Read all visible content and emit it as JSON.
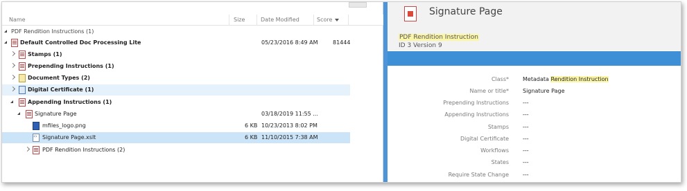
{
  "list": {
    "columns": {
      "name": "Name",
      "size": "Size",
      "date": "Date Modified",
      "score": "Score"
    },
    "group_header": "PDF Rendition Instructions (1)",
    "rows": [
      {
        "name": "Default Controlled Doc Processing Lite",
        "size": "",
        "date": "05/23/2016 8:49 AM",
        "score": "81444"
      },
      {
        "name": "Stamps",
        "count": "(1)"
      },
      {
        "name": "Prepending Instructions",
        "count": "(1)"
      },
      {
        "name": "Document Types",
        "count": "(2)"
      },
      {
        "name": "Digital Certificate",
        "count": "(1)"
      },
      {
        "name": "Appending Instructions",
        "count": "(1)"
      },
      {
        "name": "Signature Page",
        "size": "",
        "date": "03/18/2019 11:55 ...",
        "score": ""
      },
      {
        "name": "mfiles_logo.png",
        "size": "6 KB",
        "date": "10/23/2013 8:02 PM",
        "score": ""
      },
      {
        "name": "Signature Page.xslt",
        "size": "6 KB",
        "date": "11/10/2015 7:38 AM",
        "score": ""
      },
      {
        "name": "PDF Rendition Instructions",
        "count": "(2)"
      }
    ]
  },
  "details": {
    "title": "Signature Page",
    "class_name": "PDF Rendition Instruction",
    "id_version": "ID 3  Version 9",
    "properties": [
      {
        "label": "Class*",
        "value_prefix": "Metadata ",
        "value": "Rendition Instruction"
      },
      {
        "label": "Name or title*",
        "value": "Signature Page"
      },
      {
        "label": "Prepending Instructions",
        "value": "---"
      },
      {
        "label": "Appending Instructions",
        "value": "---"
      },
      {
        "label": "Stamps",
        "value": "---"
      },
      {
        "label": "Digital Certificate",
        "value": "---"
      },
      {
        "label": "Workflows",
        "value": "---"
      },
      {
        "label": "States",
        "value": "---"
      },
      {
        "label": "Require State Change",
        "value": "---"
      }
    ]
  },
  "colors": {
    "accent": "#3d8fd6",
    "selection": "#cce4f7",
    "highlight": "#fbf5a8",
    "divider": "#4d94d9"
  },
  "icons": [
    "document-icon",
    "png-file-icon",
    "xslt-file-icon",
    "folder-icon",
    "certificate-icon",
    "expand-arrow-icon",
    "collapse-arrow-icon",
    "sort-down-icon"
  ]
}
